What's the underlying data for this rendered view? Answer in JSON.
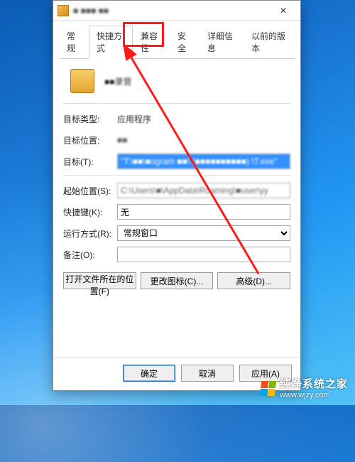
{
  "window": {
    "title": "■ ■■■ ■■",
    "close_glyph": "✕"
  },
  "tabs": {
    "items": [
      {
        "label": "常规"
      },
      {
        "label": "快捷方式"
      },
      {
        "label": "兼容性"
      },
      {
        "label": "安全"
      },
      {
        "label": "详细信息"
      },
      {
        "label": "以前的版本"
      }
    ],
    "active_index": 1
  },
  "app": {
    "name": "■■录营"
  },
  "fields": {
    "target_type_label": "目标类型:",
    "target_type_value": "应用程序",
    "target_location_label": "目标位置:",
    "target_location_value": "■■",
    "target_label": "目标(T):",
    "target_value": "\"T:\\■■\\■ogram ■■\\ (■■■■■■■■■■) \\T.exe\"",
    "start_in_label": "起始位置(S):",
    "start_in_value": "C:\\Users\\■\\AppData\\Roaming\\■user\\yy",
    "shortcut_key_label": "快捷键(K):",
    "shortcut_key_value": "无",
    "run_mode_label": "运行方式(R):",
    "run_mode_value": "常规窗口",
    "comment_label": "备注(O):",
    "comment_value": ""
  },
  "buttons": {
    "open_location": "打开文件所在的位置(F)",
    "change_icon": "更改图标(C)...",
    "advanced": "高级(D)..."
  },
  "footer": {
    "ok": "确定",
    "cancel": "取消",
    "apply": "应用(A)"
  },
  "watermark": {
    "brand": "纯净系统之家",
    "url": "www.wjzy.com"
  }
}
